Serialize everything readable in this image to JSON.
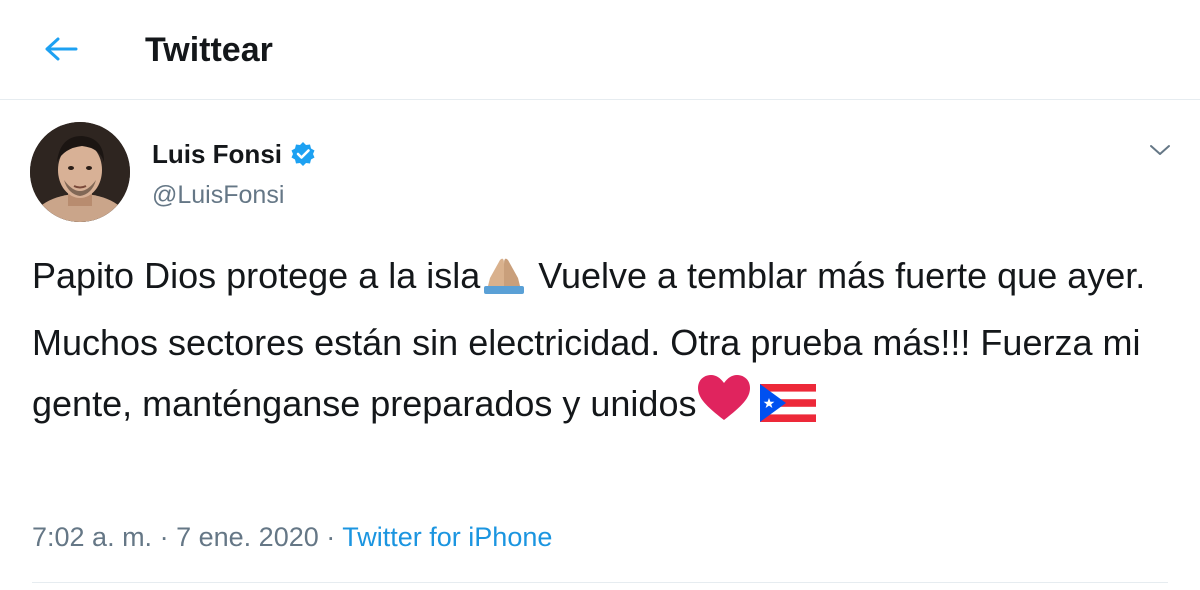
{
  "header": {
    "title": "Twittear",
    "back_icon": "arrow-left-icon"
  },
  "tweet": {
    "author_name": "Luis Fonsi",
    "author_handle": "@LuisFonsi",
    "verified": true,
    "text_1": "Papito Dios protege a la isla",
    "text_2": " Vuelve a temblar más fuerte que ayer. Muchos sectores están sin electricidad. Otra prueba más!!! Fuerza mi gente, manténganse preparados y unidos",
    "time": "7:02 a. m.",
    "separator": "·",
    "date": "7 ene. 2020",
    "source": "Twitter for iPhone",
    "emojis": [
      "folded-hands-icon",
      "red-heart-icon",
      "puerto-rico-flag-icon"
    ]
  },
  "colors": {
    "accent": "#1da1f2",
    "link": "#1b95e0",
    "secondary_text": "#657786",
    "border": "#e6ecf0",
    "heart": "#e0245e",
    "flag_red": "#ed2939",
    "flag_blue": "#0050f0"
  }
}
